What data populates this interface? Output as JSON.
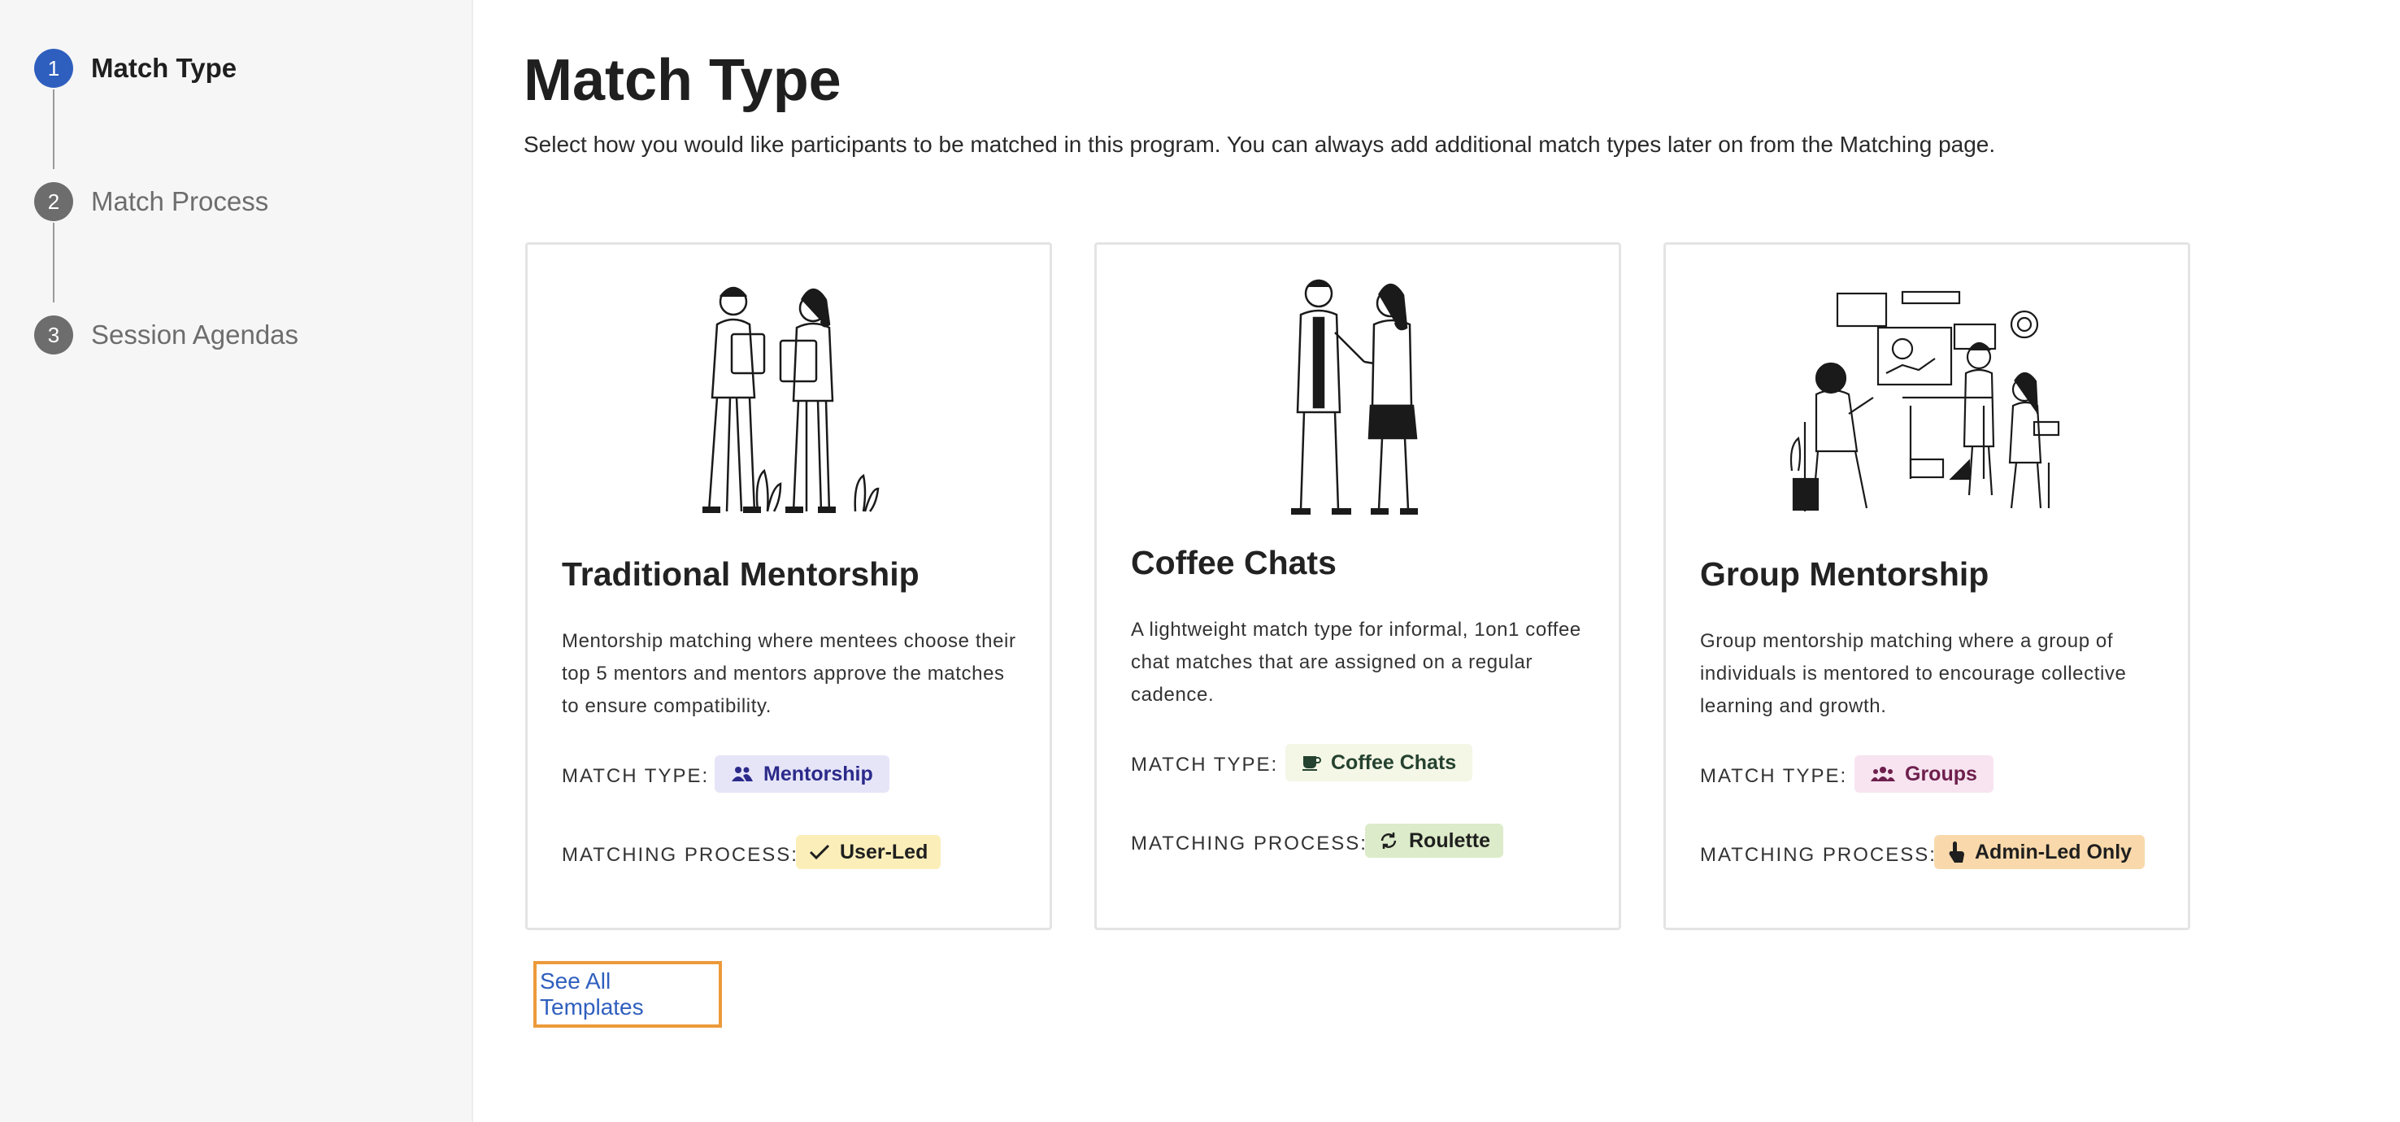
{
  "steps": [
    {
      "number": "1",
      "label": "Match Type"
    },
    {
      "number": "2",
      "label": "Match Process"
    },
    {
      "number": "3",
      "label": "Session Agendas"
    }
  ],
  "page": {
    "title": "Match Type",
    "description": "Select how you would like participants to be matched in this program. You can always add additional match types later on from the Matching page."
  },
  "cards": [
    {
      "title": "Traditional Mentorship",
      "description": "Mentorship matching where mentees choose their top 5 mentors and mentors approve the matches to ensure compatibility.",
      "match_type_label": "MATCH TYPE:",
      "match_type": "Mentorship",
      "match_type_icon": "people-icon",
      "process_label": "MATCHING PROCESS:",
      "process": "User-Led",
      "process_icon": "check-icon"
    },
    {
      "title": "Coffee Chats",
      "description": "A lightweight match type for informal, 1on1 coffee chat matches that are assigned on a regular cadence.",
      "match_type_label": "MATCH TYPE:",
      "match_type": "Coffee Chats",
      "match_type_icon": "coffee-cup-icon",
      "process_label": "MATCHING PROCESS:",
      "process": "Roulette",
      "process_icon": "refresh-icon"
    },
    {
      "title": "Group Mentorship",
      "description": "Group mentorship matching where a group of individuals is mentored to encourage collective learning and growth.",
      "match_type_label": "MATCH TYPE:",
      "match_type": "Groups",
      "match_type_icon": "groups-icon",
      "process_label": "MATCHING PROCESS:",
      "process": "Admin-Led Only",
      "process_icon": "hand-pointer-icon"
    }
  ],
  "see_all_link": "See All Templates",
  "colors": {
    "active_step": "#2f5fbe",
    "inactive_step": "#6d6d6d",
    "link": "#2f5fbe",
    "focus_outline": "#ec9a3a",
    "chip_mentorship_bg": "#e6e5f8",
    "chip_mentorship_fg": "#2b2a8a",
    "chip_user_led_bg": "#fbeeb8",
    "chip_coffee_bg": "#f4f6e6",
    "chip_coffee_fg": "#24422f",
    "chip_roulette_bg": "#dcebc9",
    "chip_groups_bg": "#f7e4f0",
    "chip_groups_fg": "#6e1f4c",
    "chip_admin_bg": "#f9d9ab"
  }
}
